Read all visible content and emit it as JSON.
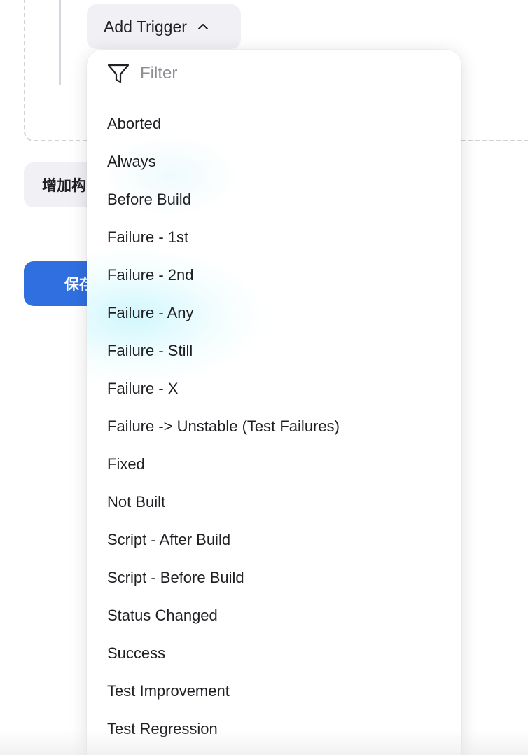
{
  "trigger_button": {
    "label": "Add Trigger",
    "icon": "chevron-up-icon"
  },
  "background_buttons": {
    "add_step_label": "增加构",
    "save_label": "保存"
  },
  "dropdown": {
    "filter_placeholder": "Filter",
    "filter_value": "",
    "filter_icon": "filter-icon",
    "options": [
      "Aborted",
      "Always",
      "Before Build",
      "Failure - 1st",
      "Failure - 2nd",
      "Failure - Any",
      "Failure - Still",
      "Failure - X",
      "Failure -> Unstable (Test Failures)",
      "Fixed",
      "Not Built",
      "Script - After Build",
      "Script - Before Build",
      "Status Changed",
      "Success",
      "Test Improvement",
      "Test Regression"
    ]
  },
  "colors": {
    "save_button": "#2f6fe0",
    "secondary_button": "#f1f1f5"
  }
}
